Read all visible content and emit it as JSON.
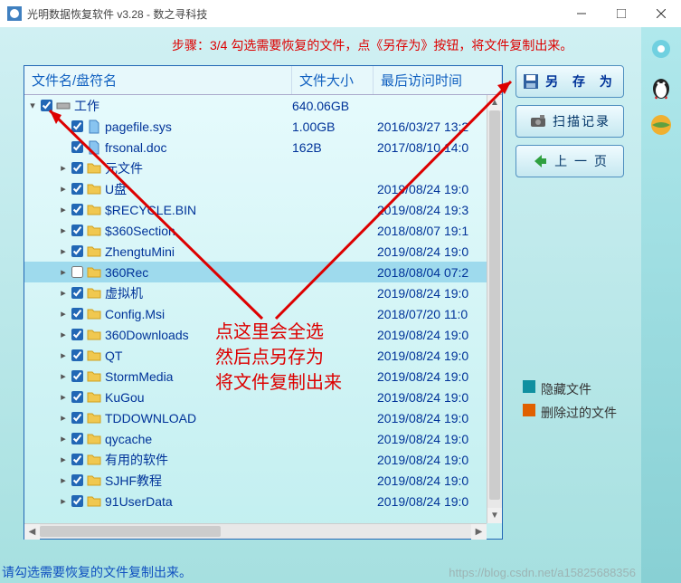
{
  "window": {
    "title": "光明数据恢复软件 v3.28 - 数之寻科技"
  },
  "step": "步骤：3/4 勾选需要恢复的文件，点《另存为》按钮，将文件复制出来。",
  "cols": {
    "name": "文件名/盘符名",
    "size": "文件大小",
    "date": "最后访问时间"
  },
  "root": {
    "name": "工作",
    "size": "640.06GB",
    "date": ""
  },
  "rows": [
    {
      "exp": "",
      "name": "pagefile.sys",
      "size": "1.00GB",
      "date": "2016/03/27 13:2",
      "type": "file"
    },
    {
      "exp": "",
      "name": "frsonal.doc",
      "size": "162B",
      "date": "2017/08/10 14:0",
      "type": "file"
    },
    {
      "exp": ">",
      "name": "元文件",
      "size": "",
      "date": "",
      "type": "folder"
    },
    {
      "exp": ">",
      "name": "U盘",
      "size": "",
      "date": "2019/08/24 19:0",
      "type": "folder"
    },
    {
      "exp": ">",
      "name": "$RECYCLE.BIN",
      "size": "",
      "date": "2019/08/24 19:3",
      "type": "folder"
    },
    {
      "exp": ">",
      "name": "$360Section",
      "size": "",
      "date": "2018/08/07 19:1",
      "type": "folder"
    },
    {
      "exp": ">",
      "name": "ZhengtuMini",
      "size": "",
      "date": "2019/08/24 19:0",
      "type": "folder"
    },
    {
      "exp": ">",
      "name": "360Rec",
      "size": "",
      "date": "2018/08/04 07:2",
      "type": "folder",
      "sel": true,
      "unchecked": true
    },
    {
      "exp": ">",
      "name": "虚拟机",
      "size": "",
      "date": "2019/08/24 19:0",
      "type": "folder"
    },
    {
      "exp": ">",
      "name": "Config.Msi",
      "size": "",
      "date": "2018/07/20 11:0",
      "type": "folder"
    },
    {
      "exp": ">",
      "name": "360Downloads",
      "size": "",
      "date": "2019/08/24 19:0",
      "type": "folder"
    },
    {
      "exp": ">",
      "name": "QT",
      "size": "",
      "date": "2019/08/24 19:0",
      "type": "folder"
    },
    {
      "exp": ">",
      "name": "StormMedia",
      "size": "",
      "date": "2019/08/24 19:0",
      "type": "folder"
    },
    {
      "exp": ">",
      "name": "KuGou",
      "size": "",
      "date": "2019/08/24 19:0",
      "type": "folder"
    },
    {
      "exp": ">",
      "name": "TDDOWNLOAD",
      "size": "",
      "date": "2019/08/24 19:0",
      "type": "folder"
    },
    {
      "exp": ">",
      "name": "qycache",
      "size": "",
      "date": "2019/08/24 19:0",
      "type": "folder"
    },
    {
      "exp": ">",
      "name": "有用的软件",
      "size": "",
      "date": "2019/08/24 19:0",
      "type": "folder"
    },
    {
      "exp": ">",
      "name": "SJHF教程",
      "size": "",
      "date": "2019/08/24 19:0",
      "type": "folder"
    },
    {
      "exp": ">",
      "name": "91UserData",
      "size": "",
      "date": "2019/08/24 19:0",
      "type": "folder"
    }
  ],
  "buttons": {
    "save": "另 存 为",
    "log": "扫描记录",
    "back": "上 一 页"
  },
  "legend": {
    "hidden": "隐藏文件",
    "deleted": "删除过的文件"
  },
  "footer": "请勾选需要恢复的文件复制出来。",
  "watermark": "https://blog.csdn.net/a15825688356",
  "anno": {
    "l1": "点这里会全选",
    "l2": "然后点另存为",
    "l3": "将文件复制出来"
  }
}
